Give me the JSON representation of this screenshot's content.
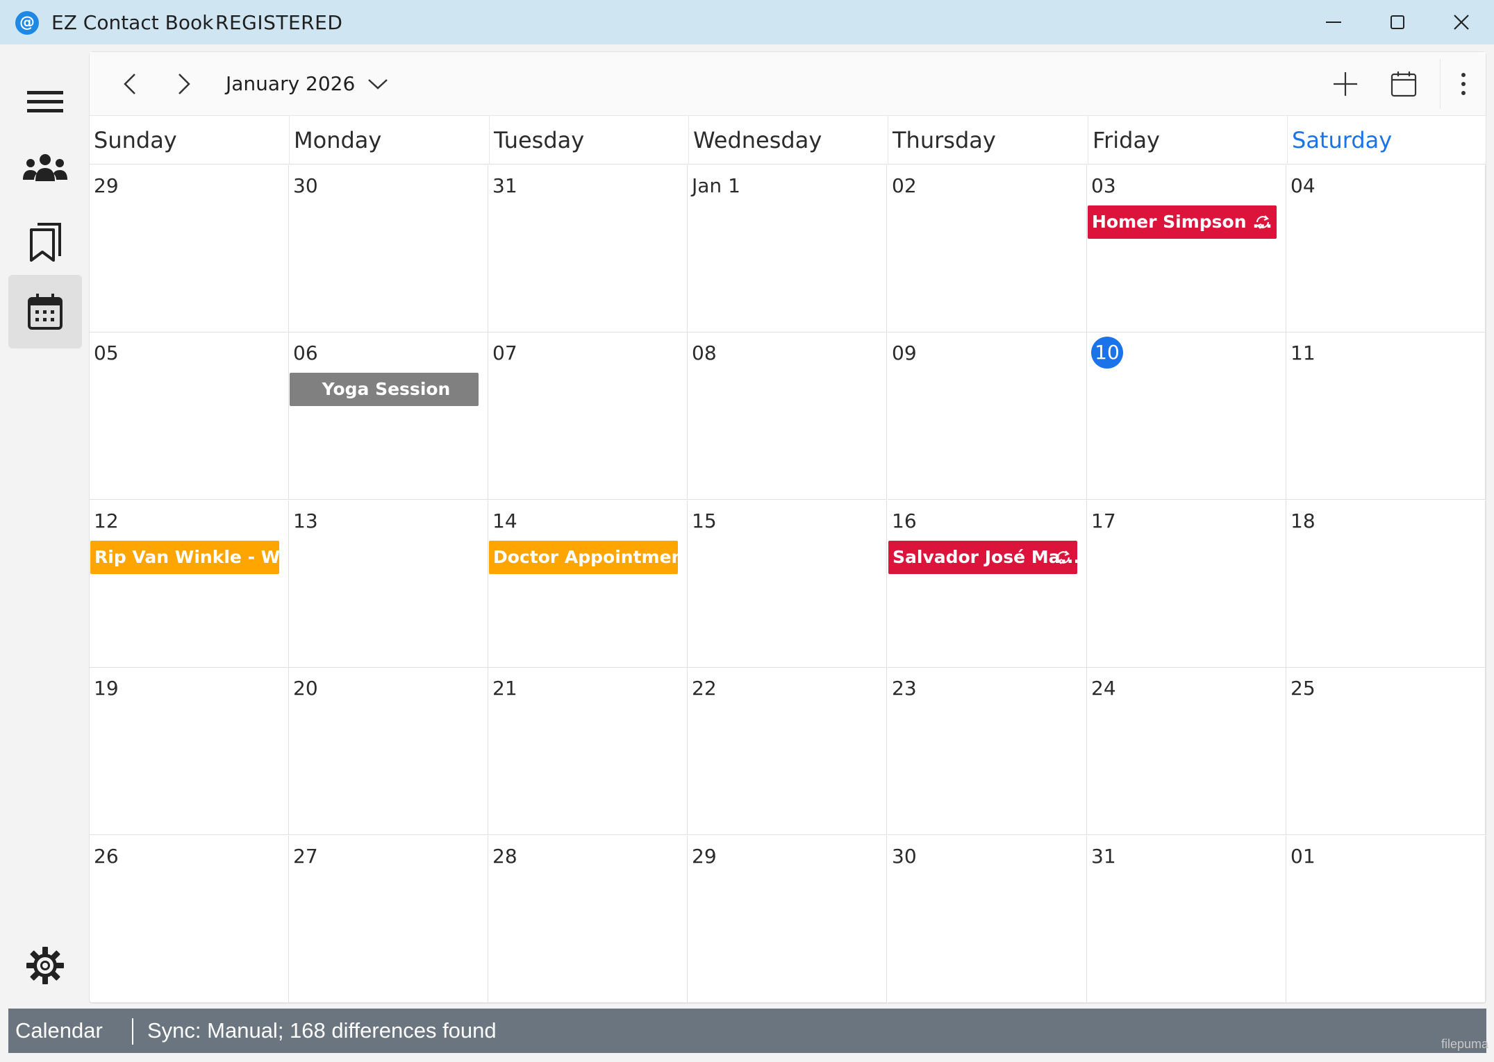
{
  "window": {
    "title": "EZ Contact Book",
    "status": "REGISTERED"
  },
  "toolbar": {
    "month_label": "January 2026"
  },
  "weekdays": [
    "Sunday",
    "Monday",
    "Tuesday",
    "Wednesday",
    "Thursday",
    "Friday",
    "Saturday"
  ],
  "weeks": [
    [
      "29",
      "30",
      "31",
      "Jan 1",
      "02",
      "03",
      "04"
    ],
    [
      "05",
      "06",
      "07",
      "08",
      "09",
      "10",
      "11"
    ],
    [
      "12",
      "13",
      "14",
      "15",
      "16",
      "17",
      "18"
    ],
    [
      "19",
      "20",
      "21",
      "22",
      "23",
      "24",
      "25"
    ],
    [
      "26",
      "27",
      "28",
      "29",
      "30",
      "31",
      "01"
    ]
  ],
  "today": "10",
  "events": [
    {
      "label": "Homer Simpson ...",
      "week": 0,
      "day": 5,
      "color": "#dc143c",
      "recurring": true
    },
    {
      "label": "Yoga Session",
      "week": 1,
      "day": 1,
      "color": "#808080",
      "recurring": false,
      "centered": true
    },
    {
      "label": "Rip Van Winkle - Wa...",
      "week": 2,
      "day": 0,
      "color": "#ffa500",
      "recurring": false
    },
    {
      "label": "Doctor Appointment",
      "week": 2,
      "day": 2,
      "color": "#ffa500",
      "recurring": false,
      "centered": true
    },
    {
      "label": "Salvador José Ma...",
      "week": 2,
      "day": 4,
      "color": "#dc143c",
      "recurring": true
    }
  ],
  "statusbar": {
    "view": "Calendar",
    "sync": "Sync: Manual; 168 differences found"
  },
  "watermark": "filepuma",
  "colors": {
    "accent": "#1a73e8",
    "statusbar": "#6b7580",
    "titlebar": "#cfe5f1"
  }
}
